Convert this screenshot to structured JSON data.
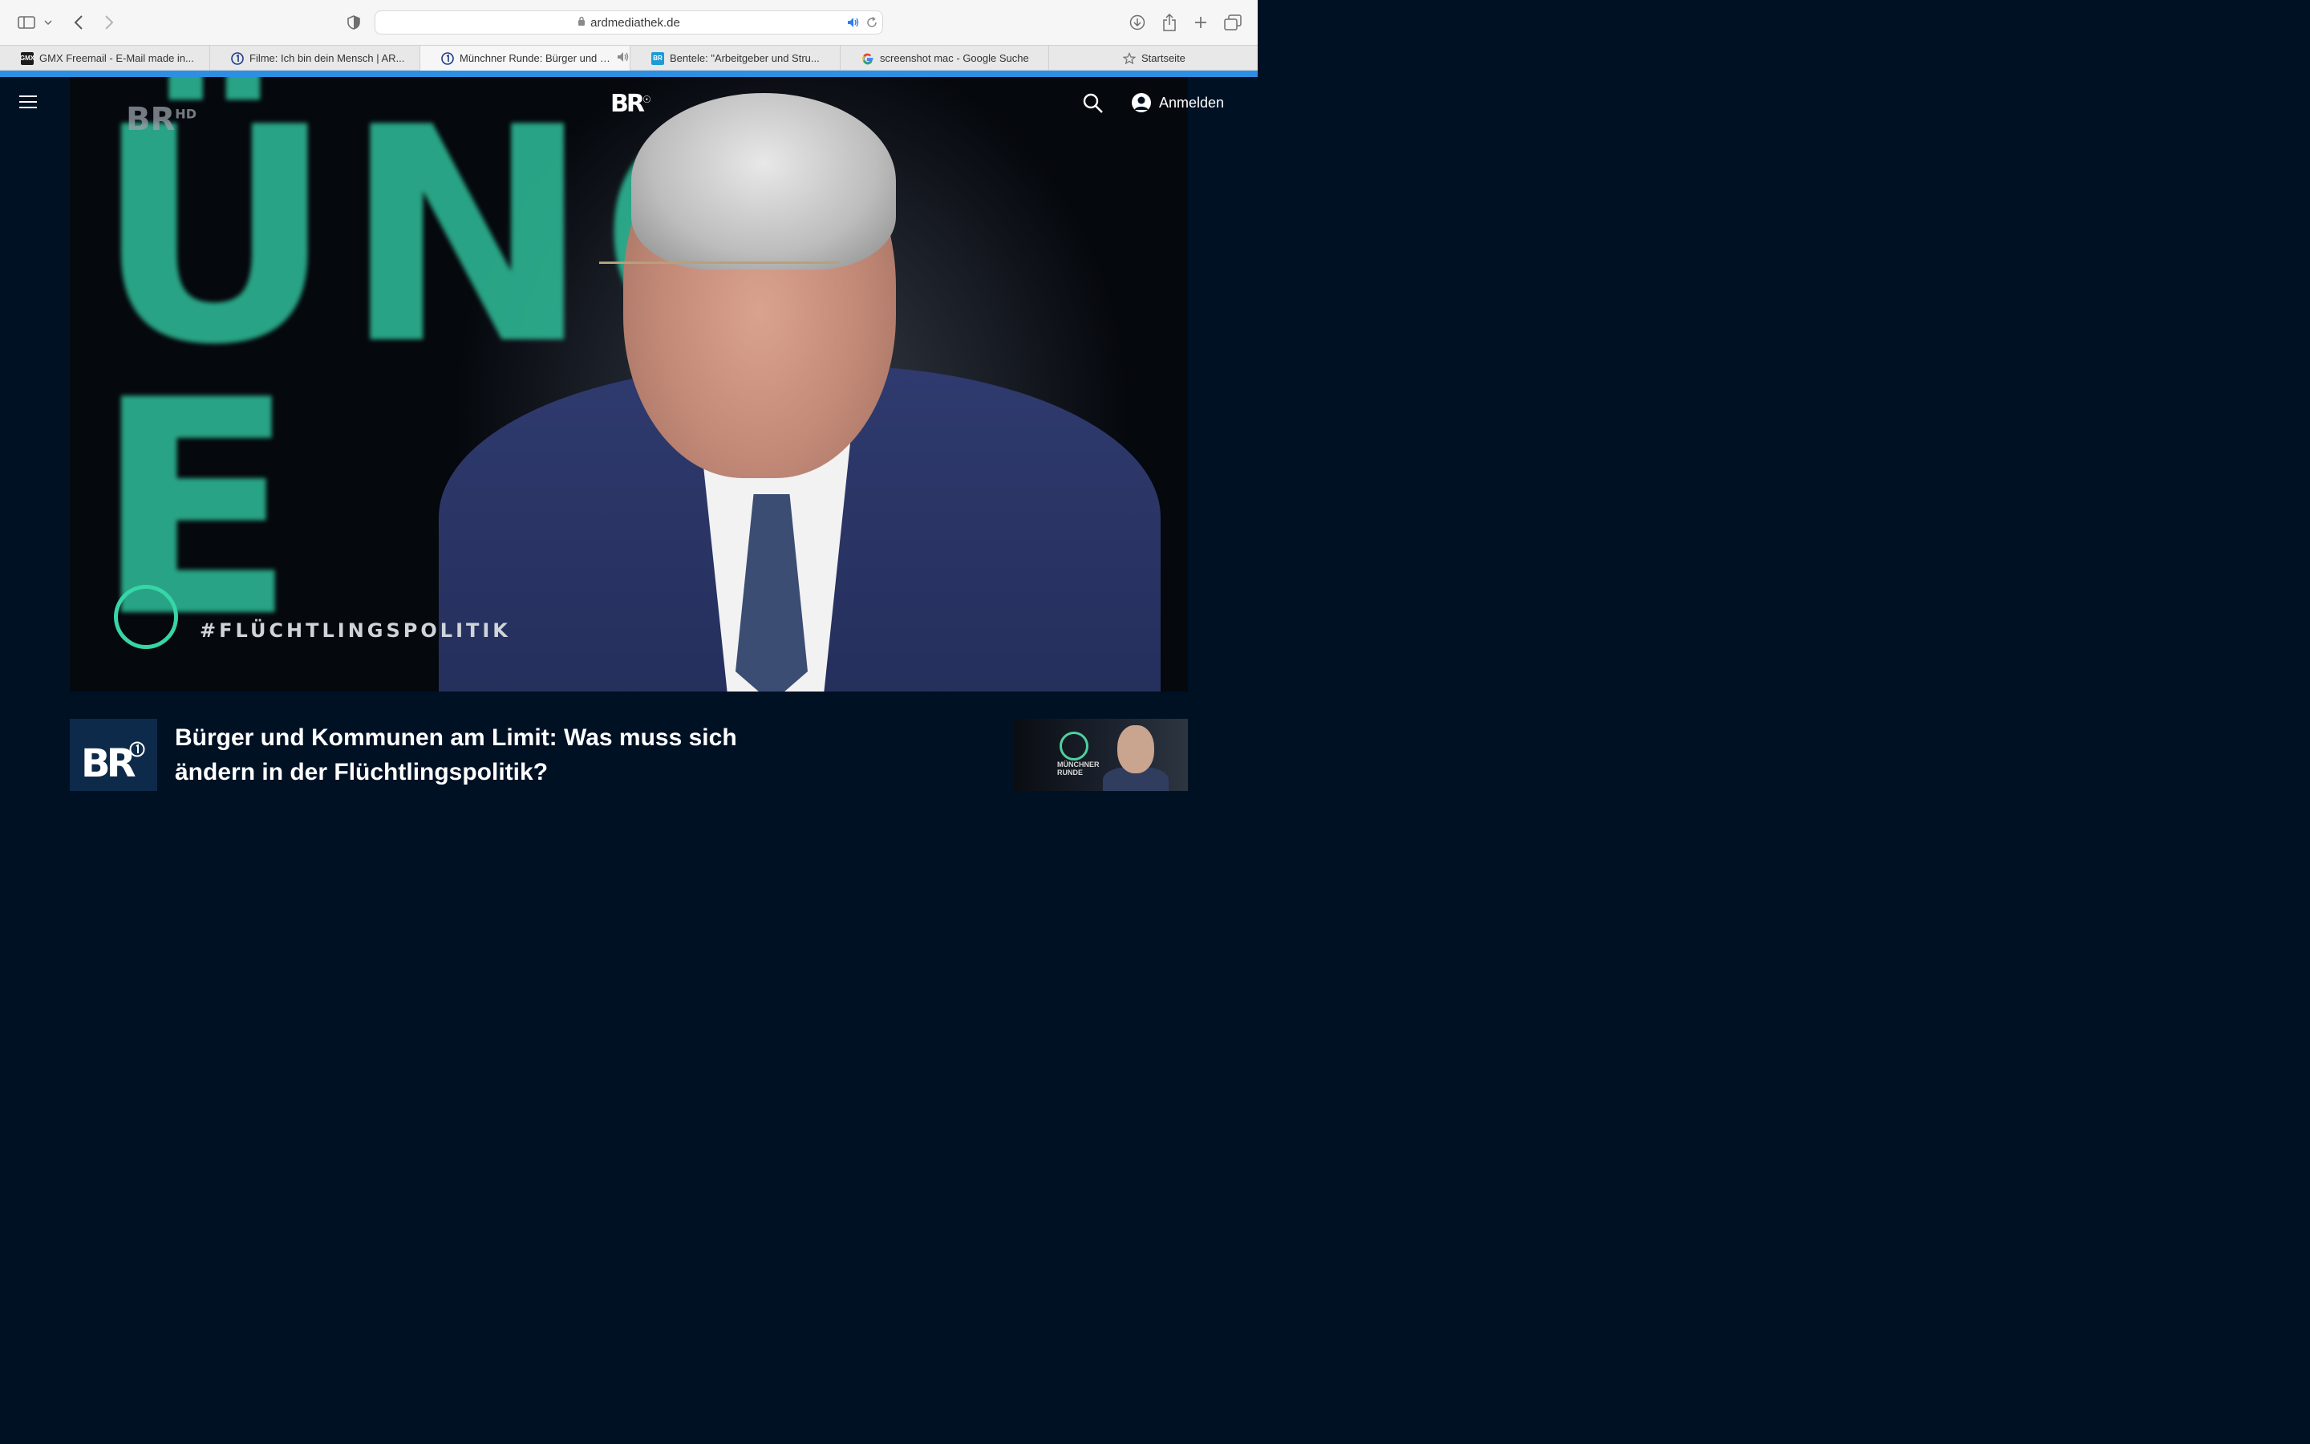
{
  "browser": {
    "url": "ardmediathek.de",
    "tabs": [
      {
        "title": "GMX Freemail - E-Mail made in...",
        "favicon": "GMX",
        "active": false
      },
      {
        "title": "Filme: Ich bin dein Mensch | AR...",
        "favicon": "ard-one-icon",
        "active": false
      },
      {
        "title": "Münchner Runde: Bürger und K...",
        "favicon": "ard-one-icon",
        "active": true,
        "audio": true
      },
      {
        "title": "Bentele: \"Arbeitgeber und Stru...",
        "favicon": "BR",
        "active": false
      },
      {
        "title": "screenshot mac - Google Suche",
        "favicon": "google-icon",
        "active": false
      },
      {
        "title": "Startseite",
        "favicon": "star-icon",
        "active": false
      }
    ]
  },
  "header": {
    "logo": "BR",
    "signin_label": "Anmelden"
  },
  "video": {
    "channel_watermark": "BR",
    "channel_watermark_sup": "HD",
    "background_letters": "ÜNG\nE",
    "hashtag": "#FLÜCHTLINGSPOLITIK"
  },
  "content": {
    "channel_logo": "BR",
    "headline": "Bürger und Kommunen am Limit: Was muss sich ändern in der Flüchtlingspolitik?",
    "thumbnail_caption": "MÜNCHNER RUNDE"
  },
  "colors": {
    "accent": "#2d8fe3",
    "page_bg": "#001124",
    "brand_green": "#37d5a7"
  }
}
